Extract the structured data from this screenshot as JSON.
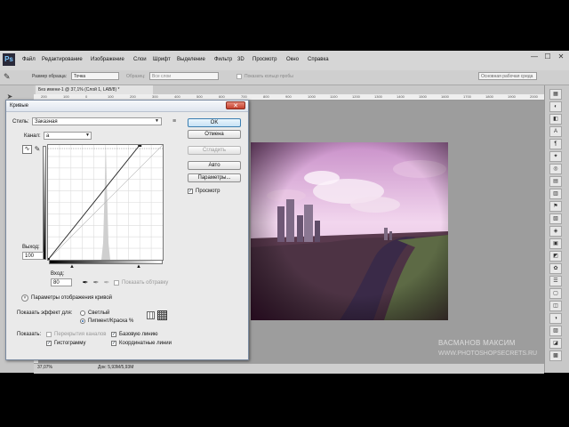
{
  "app": {
    "logo": "Ps",
    "menu": [
      "Файл",
      "Редактирование",
      "Изображение",
      "Слои",
      "Шрифт",
      "Выделение",
      "Фильтр",
      "3D",
      "Просмотр",
      "Окно",
      "Справка"
    ],
    "window_controls": [
      "—",
      "☐",
      "✕"
    ]
  },
  "options_bar": {
    "sample_size_label": "Размер образца:",
    "sample_size_value": "Точка",
    "sample_label": "Образец:",
    "sample_value": "Все слои",
    "show_ring_label": "Показать кольцо пробы",
    "workspace_value": "Основная рабочая среда"
  },
  "document": {
    "tab_title": "Без имени-1 @ 37,1% (Слой 1, LAB/8) *",
    "ruler_numbers": [
      "200",
      "100",
      "0",
      "100",
      "200",
      "300",
      "400",
      "500",
      "600",
      "700",
      "800",
      "900",
      "1000",
      "1100",
      "1200",
      "1300",
      "1400",
      "1500",
      "1600",
      "1700",
      "1800",
      "1900",
      "2000"
    ],
    "zoom": "37,07%",
    "doc_size": "Док: 5,93M/5,93M"
  },
  "watermark": {
    "line1": "ВАСМАНОВ МАКСИМ",
    "line2": "WWW.PHOTOSHOPSECRETS.RU"
  },
  "dialog": {
    "title": "Кривые",
    "close": "✕",
    "style_label": "Стиль:",
    "style_value": "Заказная",
    "channel_label": "Канал:",
    "channel_value": "a",
    "output_label": "Выход:",
    "output_value": "100",
    "input_label": "Вход:",
    "input_value": "80",
    "show_clipping": "Показать обтравку",
    "display_options": "Параметры отображения кривой",
    "show_effect_label": "Показать эффект для:",
    "radio_light": "Светлый",
    "radio_pigment": "Пигмент/Краска %",
    "show_label": "Показать:",
    "cb_channel_overlays": "Перекрытия каналов",
    "cb_baseline": "Базовую линию",
    "cb_histogram": "Гистограмму",
    "cb_intersection": "Координатные линии",
    "buttons": {
      "ok": "OK",
      "cancel": "Отмена",
      "smooth": "Сгладить",
      "auto": "Авто",
      "options": "Параметры..."
    },
    "preview_label": "Просмотр",
    "curve_points": [
      {
        "input": 0,
        "output": 0
      },
      {
        "input": 80,
        "output": 100
      }
    ]
  },
  "colors": {
    "accent_ok": "#3c7fb1",
    "close_red": "#c4402e"
  }
}
